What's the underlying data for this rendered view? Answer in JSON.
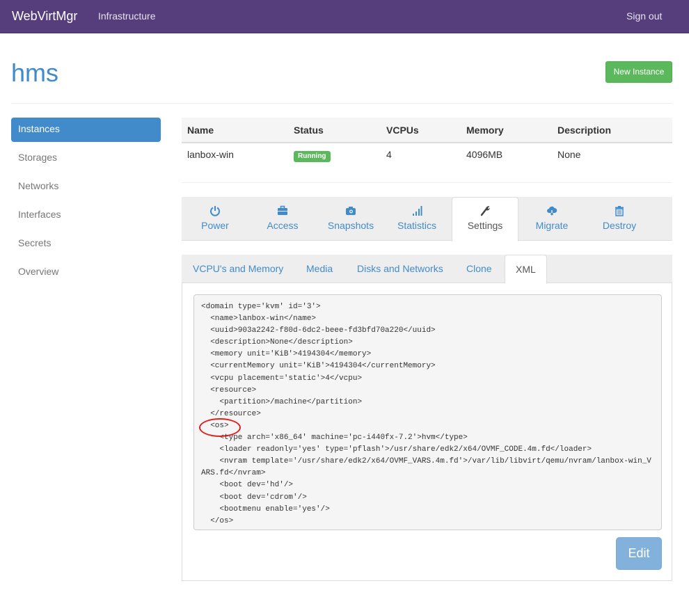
{
  "navbar": {
    "brand": "WebVirtMgr",
    "links": [
      "Infrastructure"
    ],
    "signout": "Sign out",
    "color": "#563d7c"
  },
  "page": {
    "title": "hms",
    "new_instance_label": "New Instance"
  },
  "sidebar": {
    "items": [
      {
        "label": "Instances",
        "active": true
      },
      {
        "label": "Storages",
        "active": false
      },
      {
        "label": "Networks",
        "active": false
      },
      {
        "label": "Interfaces",
        "active": false
      },
      {
        "label": "Secrets",
        "active": false
      },
      {
        "label": "Overview",
        "active": false
      }
    ]
  },
  "instance_table": {
    "headers": [
      "Name",
      "Status",
      "VCPUs",
      "Memory",
      "Description"
    ],
    "rows": [
      {
        "name": "lanbox-win",
        "status": "Running",
        "vcpus": "4",
        "memory": "4096MB",
        "description": "None"
      }
    ]
  },
  "action_tabs": [
    {
      "label": "Power",
      "icon": "power-icon",
      "active": false
    },
    {
      "label": "Access",
      "icon": "briefcase-icon",
      "active": false
    },
    {
      "label": "Snapshots",
      "icon": "camera-icon",
      "active": false
    },
    {
      "label": "Statistics",
      "icon": "signal-bars-icon",
      "active": false
    },
    {
      "label": "Settings",
      "icon": "wrench-icon",
      "active": true
    },
    {
      "label": "Migrate",
      "icon": "cloud-download-icon",
      "active": false
    },
    {
      "label": "Destroy",
      "icon": "trash-icon",
      "active": false
    }
  ],
  "settings_tabs": [
    {
      "label": "VCPU's and Memory",
      "active": false
    },
    {
      "label": "Media",
      "active": false
    },
    {
      "label": "Disks and Networks",
      "active": false
    },
    {
      "label": "Clone",
      "active": false
    },
    {
      "label": "XML",
      "active": true
    }
  ],
  "xml": {
    "content": "<domain type='kvm' id='3'>\n  <name>lanbox-win</name>\n  <uuid>903a2242-f80d-6dc2-beee-fd3bfd70a220</uuid>\n  <description>None</description>\n  <memory unit='KiB'>4194304</memory>\n  <currentMemory unit='KiB'>4194304</currentMemory>\n  <vcpu placement='static'>4</vcpu>\n  <resource>\n    <partition>/machine</partition>\n  </resource>\n  <os>\n    <type arch='x86_64' machine='pc-i440fx-7.2'>hvm</type>\n    <loader readonly='yes' type='pflash'>/usr/share/edk2/x64/OVMF_CODE.4m.fd</loader>\n    <nvram template='/usr/share/edk2/x64/OVMF_VARS.4m.fd'>/var/lib/libvirt/qemu/nvram/lanbox-win_VARS.fd</nvram>\n    <boot dev='hd'/>\n    <boot dev='cdrom'/>\n    <bootmenu enable='yes'/>\n  </os>",
    "edit_label": "Edit"
  }
}
